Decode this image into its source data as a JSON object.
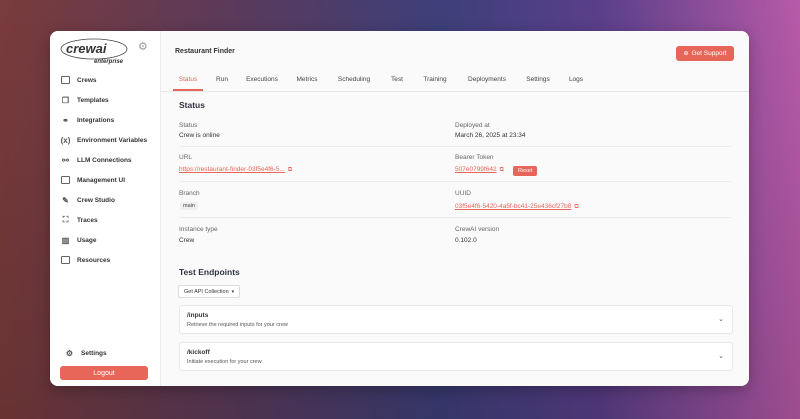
{
  "brand": {
    "logo_text": "crewai",
    "logo_subtext": "enterprise",
    "accent": "#e8655a"
  },
  "sidebar": {
    "items": [
      {
        "label": "Crews",
        "icon": "folder-icon"
      },
      {
        "label": "Templates",
        "icon": "templates-icon"
      },
      {
        "label": "Integrations",
        "icon": "link-icon"
      },
      {
        "label": "Environment Variables",
        "icon": "variable-icon"
      },
      {
        "label": "LLM Connections",
        "icon": "connection-icon"
      },
      {
        "label": "Management UI",
        "icon": "window-icon"
      },
      {
        "label": "Crew Studio",
        "icon": "edit-icon"
      },
      {
        "label": "Traces",
        "icon": "traces-icon"
      },
      {
        "label": "Usage",
        "icon": "chart-icon"
      },
      {
        "label": "Resources",
        "icon": "folder-icon"
      }
    ],
    "settings_label": "Settings",
    "logout_label": "Logout"
  },
  "header": {
    "title": "Restaurant Finder",
    "support_label": "Get Support"
  },
  "tabs": [
    {
      "label": "Status",
      "active": true
    },
    {
      "label": "Run"
    },
    {
      "label": "Executions"
    },
    {
      "label": "Metrics"
    },
    {
      "label": "Scheduling"
    },
    {
      "label": "Test"
    },
    {
      "label": "Training"
    },
    {
      "label": "Deployments"
    },
    {
      "label": "Settings"
    },
    {
      "label": "Logs"
    }
  ],
  "status": {
    "title": "Status",
    "status_label": "Status",
    "status_value": "Crew is online",
    "deployed_label": "Deployed at",
    "deployed_value": "March 26, 2025 at 23:34",
    "url_label": "URL",
    "url_value": "https://restaurant-finder-03f5e4f6-5...",
    "bearer_label": "Bearer Token",
    "bearer_value": "507e0799f642",
    "reset_label": "Reset",
    "branch_label": "Branch",
    "branch_value": "main",
    "uuid_label": "UUID",
    "uuid_value": "03f5e4f6-5420-4a5f-bc41-25e436cf27b8",
    "instance_label": "Instance type",
    "instance_value": "Crew",
    "version_label": "CrewAI version",
    "version_value": "0.102.0"
  },
  "endpoints": {
    "title": "Test Endpoints",
    "collection_label": "Get API Collection",
    "items": [
      {
        "path": "/inputs",
        "description": "Retrieve the required inputs for your crew"
      },
      {
        "path": "/kickoff",
        "description": "Initiate execution for your crew"
      }
    ]
  }
}
